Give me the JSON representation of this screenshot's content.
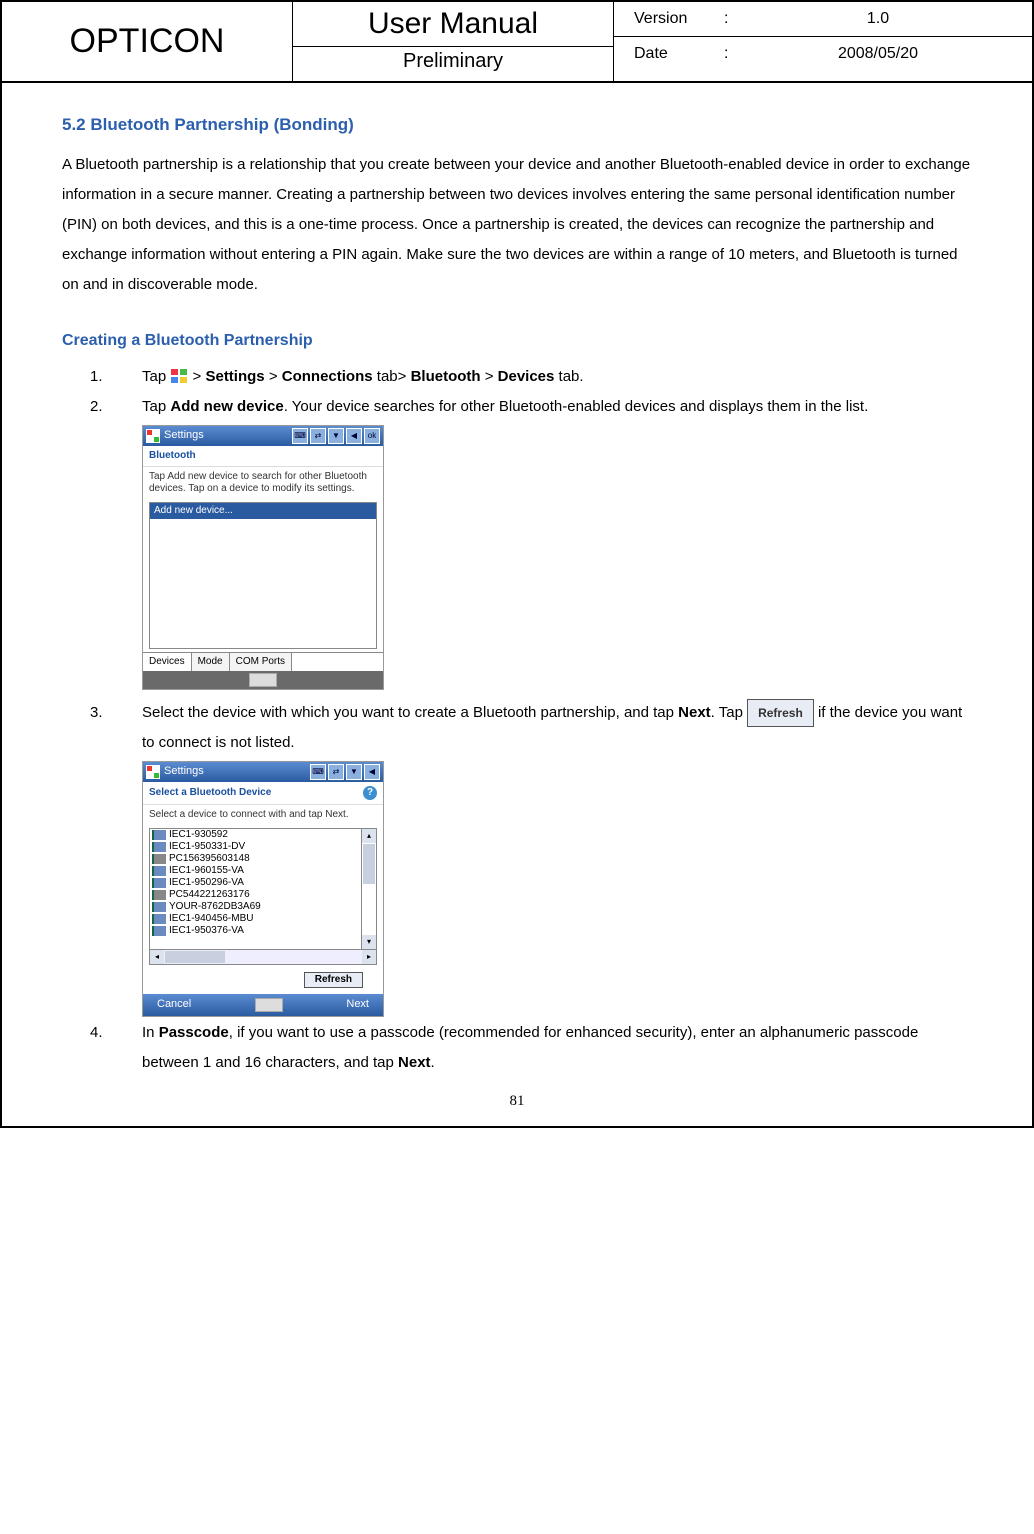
{
  "header": {
    "logo": "OPTICON",
    "title": "User Manual",
    "subtitle": "Preliminary",
    "versionLabel": "Version",
    "version": "1.0",
    "dateLabel": "Date",
    "date": "2008/05/20",
    "colon": ":"
  },
  "section": {
    "heading": "5.2 Bluetooth Partnership (Bonding)",
    "para": "A Bluetooth partnership is a relationship that you create between your device and another Bluetooth-enabled device in order to exchange information in a secure manner. Creating a partnership between two devices involves entering the same personal identification number (PIN) on both devices, and this is a one-time process. Once a partnership is created, the devices can recognize the partnership and exchange information without entering a PIN again. Make sure the two devices are within a range of 10 meters, and Bluetooth is turned on and in discoverable mode.",
    "subheading": "Creating a Bluetooth Partnership"
  },
  "steps": {
    "n1": "1.",
    "s1a": "Tap ",
    "s1b": " > ",
    "s1c": "Settings",
    "s1d": " > ",
    "s1e": "Connections",
    "s1f": " tab> ",
    "s1g": "Bluetooth",
    "s1h": " > ",
    "s1i": "Devices",
    "s1j": " tab.",
    "n2": "2.",
    "s2a": "Tap ",
    "s2b": "Add new device",
    "s2c": ". Your device searches for other Bluetooth-enabled devices and displays them in the list.",
    "n3": "3.",
    "s3a": "Select the device with which you want to create a Bluetooth partnership, and tap ",
    "s3b": "Next",
    "s3c": ". Tap ",
    "s3btn": "Refresh",
    "s3d": " if the device you want to connect is not listed.",
    "n4": "4.",
    "s4a": "In ",
    "s4b": "Passcode",
    "s4c": ", if you want to use a passcode (recommended for enhanced security), enter an alphanumeric passcode between 1 and 16 characters, and tap ",
    "s4d": "Next",
    "s4e": "."
  },
  "screen1": {
    "title": "Settings",
    "ok": "ok",
    "sub": "Bluetooth",
    "txt": "Tap Add new device to search for other Bluetooth devices. Tap on a device to modify its settings.",
    "sel": "Add new device...",
    "tab1": "Devices",
    "tab2": "Mode",
    "tab3": "COM Ports"
  },
  "screen2": {
    "title": "Settings",
    "sub": "Select a Bluetooth Device",
    "txt": "Select a device to connect with and tap Next.",
    "d1": "IEC1-930592",
    "d2": "IEC1-950331-DV",
    "d3": "PC156395603148",
    "d4": "IEC1-960155-VA",
    "d5": "IEC1-950296-VA",
    "d6": "PC544221263176",
    "d7": "YOUR-8762DB3A69",
    "d8": "IEC1-940456-MBU",
    "d9": "IEC1-950376-VA",
    "refresh": "Refresh",
    "cancel": "Cancel",
    "next": "Next"
  },
  "pagenum": "81"
}
